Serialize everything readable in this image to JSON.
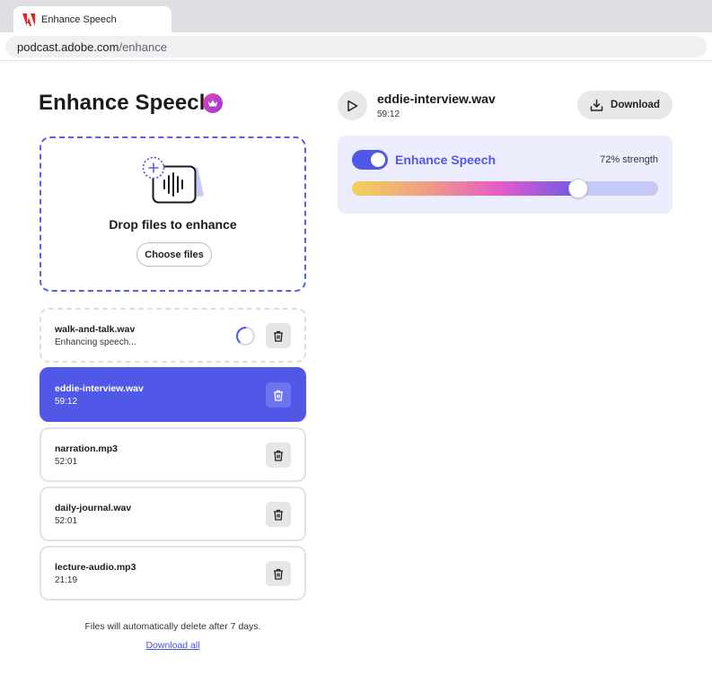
{
  "browser": {
    "tab_title": "Enhance Speech",
    "url_host": "podcast.adobe.com",
    "url_path": "/enhance"
  },
  "page": {
    "title": "Enhance Speech",
    "title_badge_icon": "crown-icon"
  },
  "dropzone": {
    "prompt": "Drop files to enhance",
    "choose_label": "Choose files",
    "icon": "audio-file-add-icon"
  },
  "files": [
    {
      "name": "walk-and-talk.wav",
      "meta": "Enhancing speech...",
      "state": "processing"
    },
    {
      "name": "eddie-interview.wav",
      "meta": "59:12",
      "state": "selected"
    },
    {
      "name": "narration.mp3",
      "meta": "52:01",
      "state": "normal"
    },
    {
      "name": "daily-journal.wav",
      "meta": "52:01",
      "state": "normal"
    },
    {
      "name": "lecture-audio.mp3",
      "meta": "21:19",
      "state": "normal"
    }
  ],
  "footer": {
    "note": "Files will automatically delete after 7 days.",
    "download_all": "Download all"
  },
  "player": {
    "track_name": "eddie-interview.wav",
    "duration": "59:12",
    "download_label": "Download"
  },
  "enhance": {
    "label": "Enhance Speech",
    "enabled": true,
    "strength_text": "72% strength",
    "strength_value": 0.72
  },
  "colors": {
    "accent": "#5158e8",
    "panel_bg": "#edeefd",
    "dropzone_border": "#5a5fe3",
    "adobe_red": "#e1251b"
  }
}
